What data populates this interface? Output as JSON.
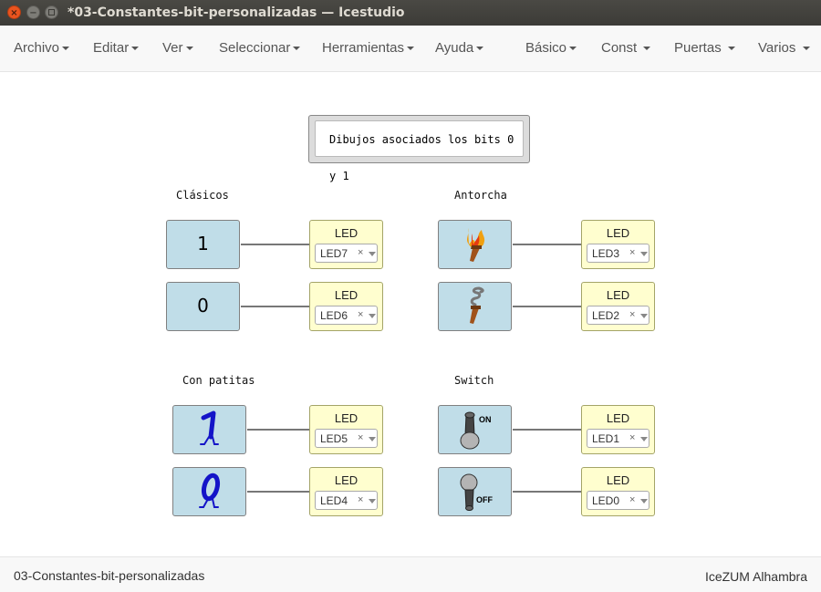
{
  "window": {
    "title": "*03-Constantes-bit-personalizadas — Icestudio",
    "close_icon": "close-icon",
    "minimize_icon": "minimize-icon",
    "maximize_icon": "maximize-icon"
  },
  "menu": {
    "left": [
      "Archivo",
      "Editar",
      "Ver",
      "Seleccionar",
      "Herramientas",
      "Ayuda"
    ],
    "right": [
      "Básico",
      "Const",
      "Puertas",
      "Varios"
    ]
  },
  "canvas": {
    "info_text": "Dibujos asociados los bits 0 y 1",
    "groups": [
      {
        "label": "Clásicos",
        "blocks": [
          {
            "constant": "1",
            "icon": "digit-1",
            "led_title": "LED",
            "led_value": "LED7"
          },
          {
            "constant": "0",
            "icon": "digit-0",
            "led_title": "LED",
            "led_value": "LED6"
          }
        ]
      },
      {
        "label": "Antorcha",
        "blocks": [
          {
            "constant": "1",
            "icon": "lit-torch-icon",
            "led_title": "LED",
            "led_value": "LED3"
          },
          {
            "constant": "0",
            "icon": "smoking-torch-icon",
            "led_title": "LED",
            "led_value": "LED2"
          }
        ]
      },
      {
        "label": "Con patitas",
        "blocks": [
          {
            "constant": "1",
            "icon": "one-with-legs-icon",
            "led_title": "LED",
            "led_value": "LED5"
          },
          {
            "constant": "0",
            "icon": "zero-with-legs-icon",
            "led_title": "LED",
            "led_value": "LED4"
          }
        ]
      },
      {
        "label": "Switch",
        "blocks": [
          {
            "constant": "1",
            "icon": "switch-on-icon",
            "icon_text": "ON",
            "led_title": "LED",
            "led_value": "LED1"
          },
          {
            "constant": "0",
            "icon": "switch-off-icon",
            "icon_text": "OFF",
            "led_title": "LED",
            "led_value": "LED0"
          }
        ]
      }
    ],
    "led_clear_symbol": "×"
  },
  "status": {
    "file": "03-Constantes-bit-personalizadas",
    "board": "IceZUM Alhambra"
  },
  "colors": {
    "titlebar": "#3c3b37",
    "close_button": "#e9541f",
    "constant_block": "#c0dde8",
    "led_block": "#fffecf",
    "wire": "#777777",
    "drawing_blue": "#1414c8"
  }
}
